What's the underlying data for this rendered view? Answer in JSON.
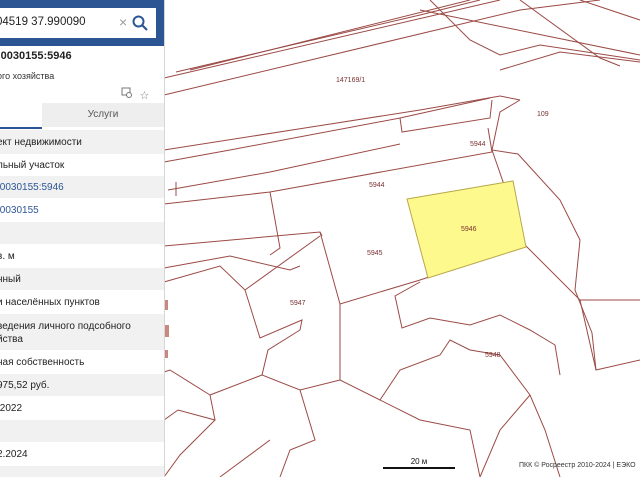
{
  "search": {
    "value": "04519 37.990090"
  },
  "panel": {
    "title": ":0030155:5946",
    "subtitle": "ого хозяйства",
    "tabs": {
      "services": "Услуги"
    },
    "rows": [
      {
        "text": "ект недвижимости"
      },
      {
        "text": "льный участок"
      },
      {
        "text": ":0030155:5946"
      },
      {
        "text": ":0030155"
      },
      {
        "text": ""
      },
      {
        "text": "в. м"
      },
      {
        "text": "нный"
      },
      {
        "text": "и населённых пунктов"
      },
      {
        "text": "ведения личного подсобного"
      },
      {
        "text": "йства"
      },
      {
        "text": "ная собственность"
      },
      {
        "text": "975,52 руб."
      },
      {
        "text": ".2022"
      },
      {
        "text": ""
      },
      {
        "text": "2.2024"
      }
    ]
  },
  "map": {
    "parcels": [
      "147169/1",
      "109",
      "5944",
      "5944",
      "5946",
      "5945",
      "5947",
      "5948"
    ],
    "selected_fill": "#fdf98d",
    "boundary_color": "#9b4a45",
    "scale": "20 м",
    "copyright": "ПКК © Росреестр 2010-2024 | ЕЭКО"
  },
  "colors": {
    "accent": "#2c5594"
  }
}
